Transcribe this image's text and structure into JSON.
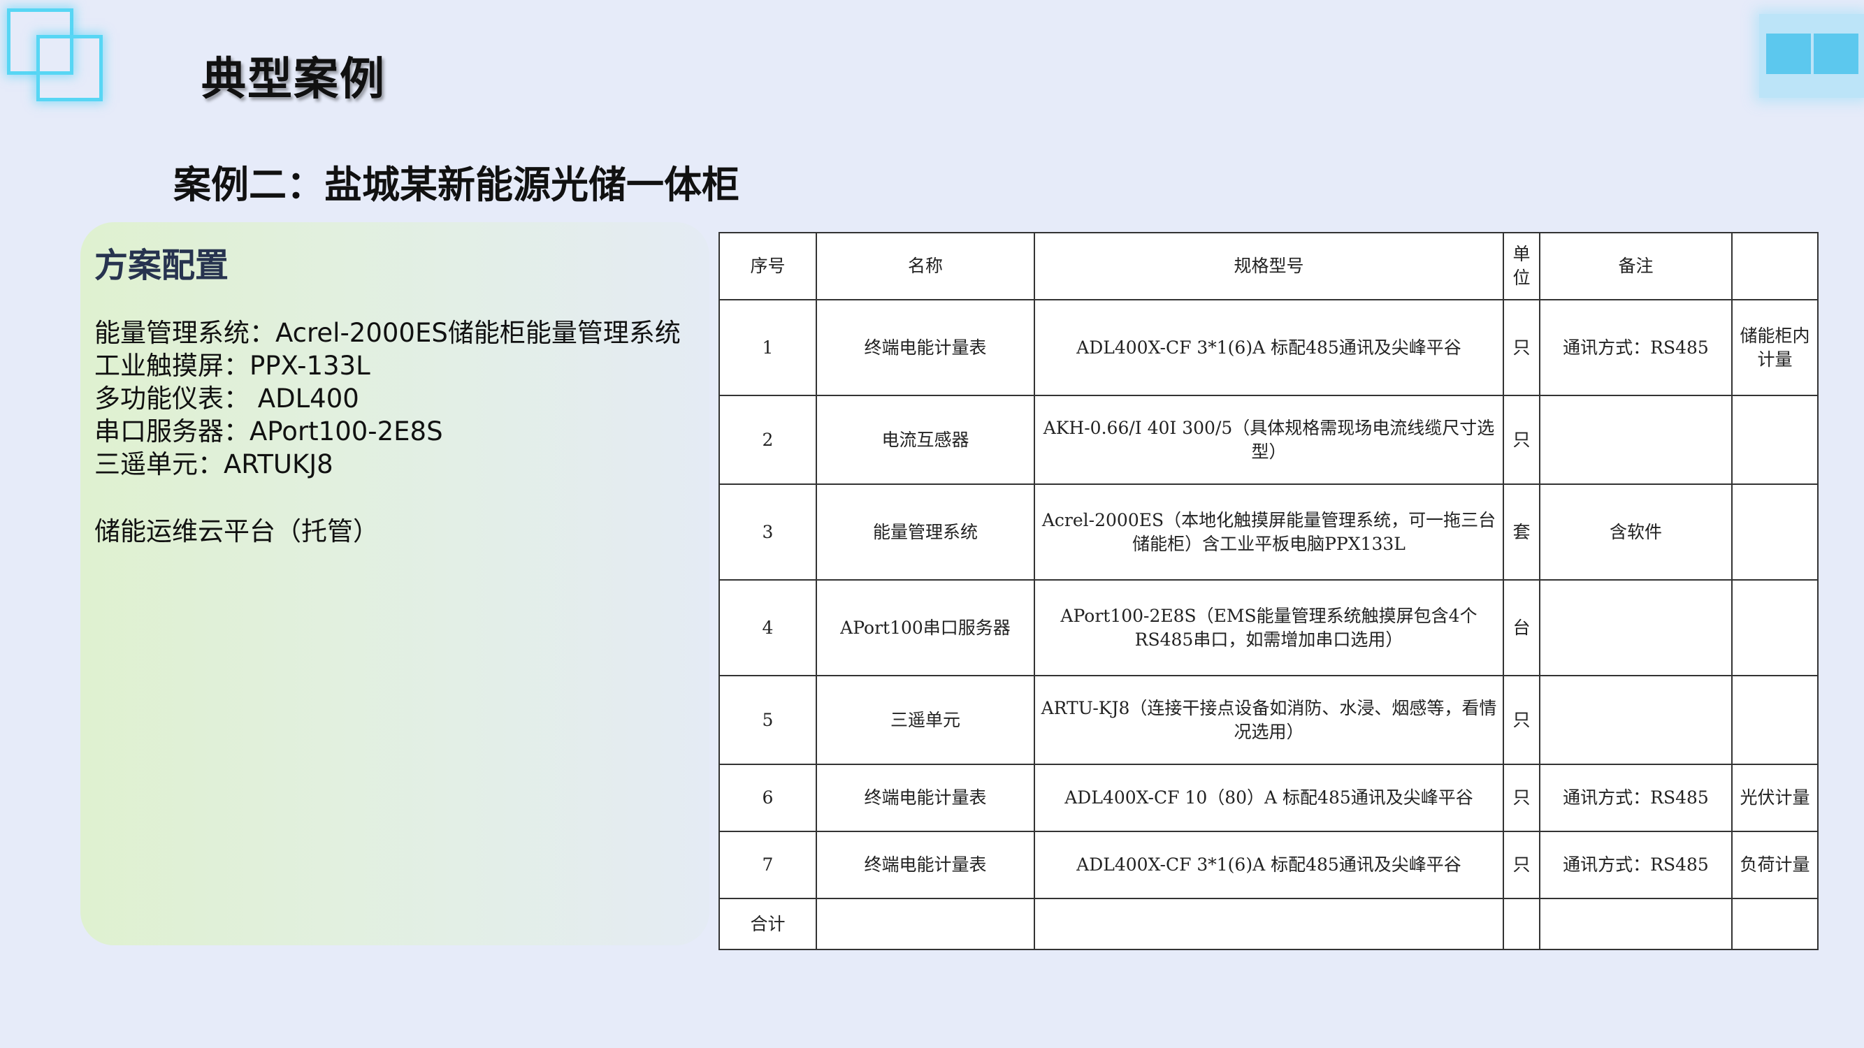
{
  "page": {
    "title": "典型案例",
    "case_title": "案例二：盐城某新能源光储一体柜"
  },
  "panel": {
    "heading": "方案配置",
    "lines": [
      "能量管理系统：Acrel-2000ES储能柜能量管理系统",
      "工业触摸屏：PPX-133L",
      "多功能仪表： ADL400",
      "串口服务器：APort100-2E8S",
      "三遥单元：ARTUKJ8"
    ],
    "cloud": "储能运维云平台（托管）"
  },
  "table": {
    "headers": [
      "序号",
      "名称",
      "规格型号",
      "单位",
      "备注",
      ""
    ],
    "rows": [
      [
        "1",
        "终端电能计量表",
        "ADL400X-CF 3*1(6)A 标配485通讯及尖峰平谷",
        "只",
        "通讯方式：RS485",
        "储能柜内计量"
      ],
      [
        "2",
        "电流互感器",
        "AKH-0.66/I 40I 300/5（具体规格需现场电流线缆尺寸选型）",
        "只",
        "",
        ""
      ],
      [
        "3",
        "能量管理系统",
        "Acrel-2000ES（本地化触摸屏能量管理系统，可一拖三台储能柜）含工业平板电脑PPX133L",
        "套",
        "含软件",
        ""
      ],
      [
        "4",
        "APort100串口服务器",
        "APort100-2E8S（EMS能量管理系统触摸屏包含4个RS485串口，如需增加串口选用）",
        "台",
        "",
        ""
      ],
      [
        "5",
        "三遥单元",
        "ARTU-KJ8（连接干接点设备如消防、水浸、烟感等，看情况选用）",
        "只",
        "",
        ""
      ],
      [
        "6",
        "终端电能计量表",
        "ADL400X-CF 10（80）A 标配485通讯及尖峰平谷",
        "只",
        "通讯方式：RS485",
        "光伏计量"
      ],
      [
        "7",
        "终端电能计量表",
        "ADL400X-CF 3*1(6)A 标配485通讯及尖峰平谷",
        "只",
        "通讯方式：RS485",
        "负荷计量"
      ],
      [
        "合计",
        "",
        "",
        "",
        "",
        ""
      ]
    ]
  },
  "colors": {
    "background": "#e6ebf9",
    "accent_cyan": "#57d6f4",
    "panel_green": "#dff1d0",
    "heading_navy": "#27334f"
  }
}
